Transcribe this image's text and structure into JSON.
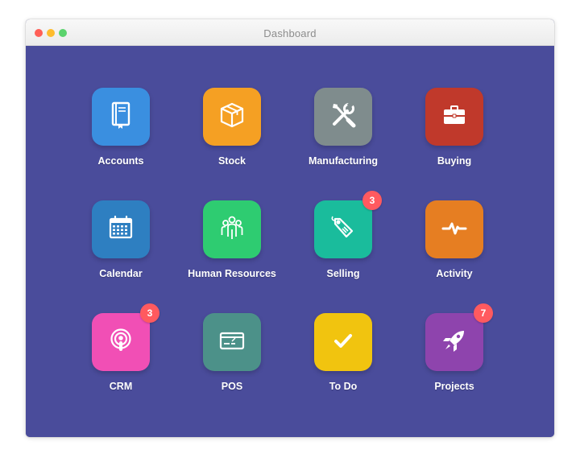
{
  "window": {
    "title": "Dashboard"
  },
  "colors": {
    "background": "#4a4c9b",
    "badge": "#ff5a5f"
  },
  "apps": [
    {
      "label": "Accounts",
      "icon": "book-icon",
      "color": "#3a8fe0"
    },
    {
      "label": "Stock",
      "icon": "box-icon",
      "color": "#f5a023"
    },
    {
      "label": "Manufacturing",
      "icon": "tools-icon",
      "color": "#7f8c8d"
    },
    {
      "label": "Buying",
      "icon": "briefcase-icon",
      "color": "#c0392b"
    },
    {
      "label": "Calendar",
      "icon": "calendar-icon",
      "color": "#2e7fc1"
    },
    {
      "label": "Human Resources",
      "icon": "people-icon",
      "color": "#2ecc71"
    },
    {
      "label": "Selling",
      "icon": "tag-icon",
      "color": "#1abc9c",
      "badge": "3"
    },
    {
      "label": "Activity",
      "icon": "pulse-icon",
      "color": "#e67e22"
    },
    {
      "label": "CRM",
      "icon": "podcast-icon",
      "color": "#f14fb5",
      "badge": "3"
    },
    {
      "label": "POS",
      "icon": "credit-card-icon",
      "color": "#4c9189"
    },
    {
      "label": "To Do",
      "icon": "check-icon",
      "color": "#f1c40f"
    },
    {
      "label": "Projects",
      "icon": "rocket-icon",
      "color": "#8e44ad",
      "badge": "7"
    }
  ]
}
